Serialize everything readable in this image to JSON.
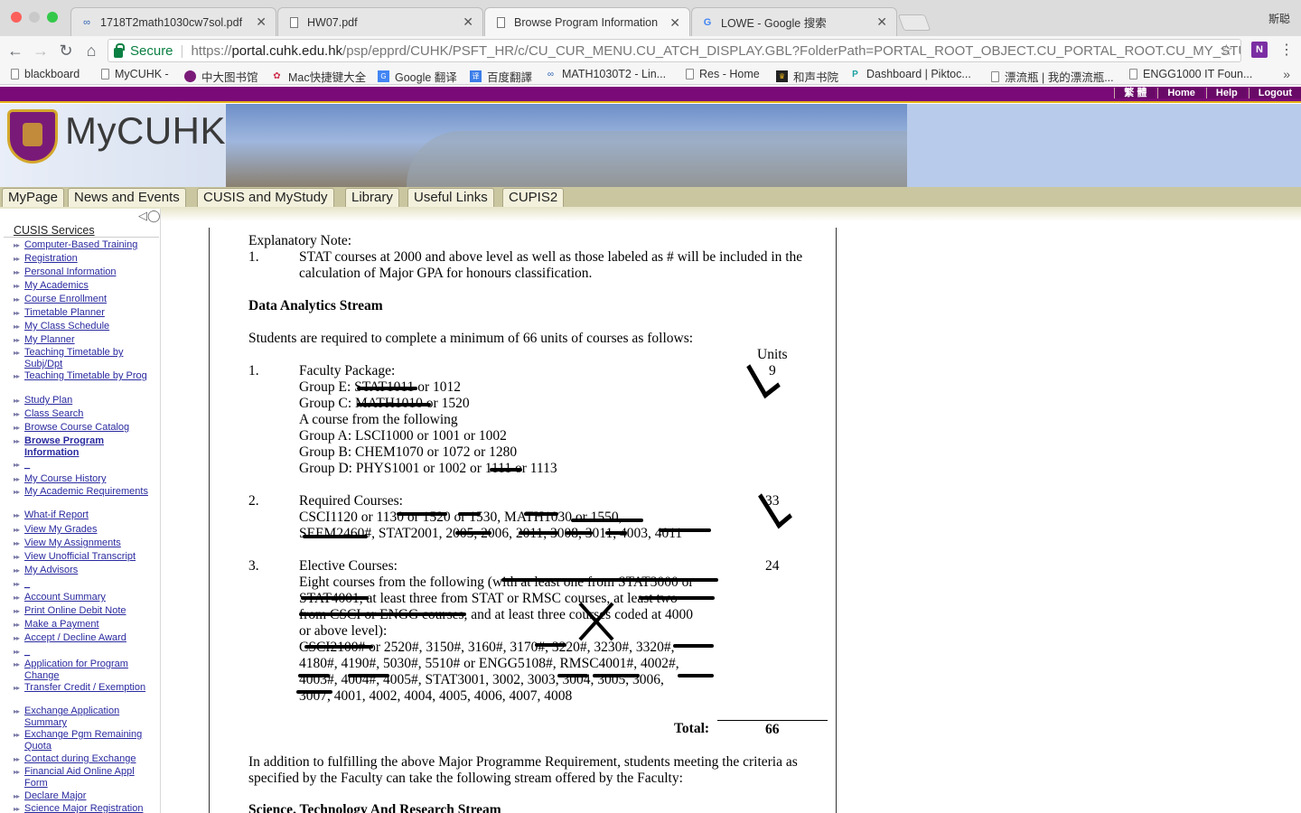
{
  "browser": {
    "profile_name": "斯聪",
    "tabs": [
      {
        "icon": "blackboard-icon",
        "title": "1718T2math1030cw7sol.pdf"
      },
      {
        "icon": "pdf-icon",
        "title": "HW07.pdf"
      },
      {
        "icon": "page-icon",
        "title": "Browse Program Information"
      },
      {
        "icon": "google-icon",
        "title": "LOWE - Google 搜索"
      }
    ],
    "active_tab": 2,
    "omnibox": {
      "secure_label": "Secure",
      "url_scheme": "https://",
      "url_host": "portal.cuhk.edu.hk",
      "url_path": "/psp/epprd/CUHK/PSFT_HR/c/CU_CUR_MENU.CU_ATCH_DISPLAY.GBL?FolderPath=PORTAL_ROOT_OBJECT.CU_PORTAL_ROOT.CU_MY_STUDY_MY_T..."
    },
    "extension_label": "N",
    "bookmarks": [
      {
        "icon": "page-icon",
        "label": "blackboard"
      },
      {
        "icon": "page-icon",
        "label": "MyCUHK -"
      },
      {
        "icon": "library-icon",
        "label": "中大图书馆"
      },
      {
        "icon": "mac-icon",
        "label": "Mac快捷键大全"
      },
      {
        "icon": "google-translate-icon",
        "label": "Google 翻译"
      },
      {
        "icon": "baidu-translate-icon",
        "label": "百度翻譯"
      },
      {
        "icon": "blackboard-icon",
        "label": "MATH1030T2 - Lin..."
      },
      {
        "icon": "page-icon",
        "label": "Res - Home"
      },
      {
        "icon": "bookstore-icon",
        "label": "和声书院"
      },
      {
        "icon": "piktochart-icon",
        "label": "Dashboard | Piktoc..."
      },
      {
        "icon": "page-icon",
        "label": "漂流瓶 | 我的漂流瓶..."
      },
      {
        "icon": "page-icon",
        "label": "ENGG1000 IT Foun..."
      }
    ]
  },
  "portal": {
    "logo_text": "MyCUHK",
    "top_links": [
      "繁 體",
      "Home",
      "Help",
      "Logout"
    ],
    "menu_tabs": [
      "MyPage",
      "News and Events",
      "CUSIS and MyStudy",
      "Library",
      "Useful Links",
      "CUPIS2"
    ]
  },
  "sidebar": {
    "header": "CUSIS Services",
    "current": "Browse Program Information",
    "items": [
      "Computer-Based Training",
      "Registration",
      "Personal Information",
      "My Academics",
      "Course Enrollment",
      "Timetable Planner",
      "My Class Schedule",
      "My Planner",
      "Teaching Timetable by Subj/Dpt",
      "Teaching Timetable by Prog",
      "Study Plan",
      "Class Search",
      "Browse Course Catalog",
      "Browse Program Information",
      "_",
      "My Course History",
      "My Academic Requirements",
      "What-if Report",
      "View My Grades",
      "View My Assignments",
      "View Unofficial Transcript",
      "My Advisors",
      "_",
      "Account Summary",
      "Print Online Debit Note",
      "Make a Payment",
      "Accept / Decline Award",
      "_",
      "Application for Program Change",
      "Transfer Credit / Exemption",
      "Exchange Application Summary",
      "Exchange Pgm Remaining Quota",
      "Contact during Exchange",
      "Financial Aid Online Appl Form",
      "Declare Major",
      "Science Major Registration"
    ]
  },
  "document": {
    "explanatory_title": "Explanatory Note:",
    "note_num": "1.",
    "note_line1": "STAT courses at 2000 and above level as well as those labeled as # will be included in the",
    "note_line2": "calculation of Major GPA for honours classification.",
    "stream_title": "Data Analytics Stream",
    "intro": "Students are required to complete a minimum of 66 units of courses as follows:",
    "units_header": "Units",
    "sections": [
      {
        "num": "1.",
        "title": "Faculty Package:",
        "units": "9",
        "lines": [
          "Group E: STAT1011 or 1012",
          "Group C: MATH1010 or 1520",
          "A course from the following",
          "Group A: LSCI1000 or 1001 or 1002",
          "Group B: CHEM1070 or 1072 or 1280",
          "Group D: PHYS1001 or 1002 or 1111 or 1113"
        ]
      },
      {
        "num": "2.",
        "title": "Required Courses:",
        "units": "33",
        "lines": [
          "CSCI1120 or 1130 or 1520 or 1530, MATH1030 or 1550,",
          "SEEM2460#, STAT2001, 2005, 2006, 2011, 3008, 3011, 4003, 4011"
        ]
      },
      {
        "num": "3.",
        "title": "Elective Courses:",
        "units": "24",
        "lines": [
          "Eight courses from the following (with at least one from STAT3000 or",
          "STAT4001, at least three from STAT or RMSC courses, at least two",
          "from CSCI or ENGG courses, and at least three courses coded at 4000",
          "or above level):",
          "CSCI2100# or 2520#, 3150#, 3160#, 3170#, 3220#, 3230#, 3320#,",
          "4180#, 4190#, 5030#, 5510# or ENGG5108#, RMSC4001#, 4002#,",
          "4003#, 4004#, 4005#, STAT3001, 3002, 3003, 3004, 3005, 3006,",
          "3007, 4001, 4002, 4004, 4005, 4006, 4007, 4008"
        ]
      }
    ],
    "total_label": "Total:",
    "total_value": "66",
    "addition_line1": "In addition to fulfilling the above Major Programme Requirement, students meeting the criteria as",
    "addition_line2": "specified by the Faculty can take the following stream offered by the Faculty:",
    "next_stream_title": "Science, Technology And Research Stream"
  }
}
